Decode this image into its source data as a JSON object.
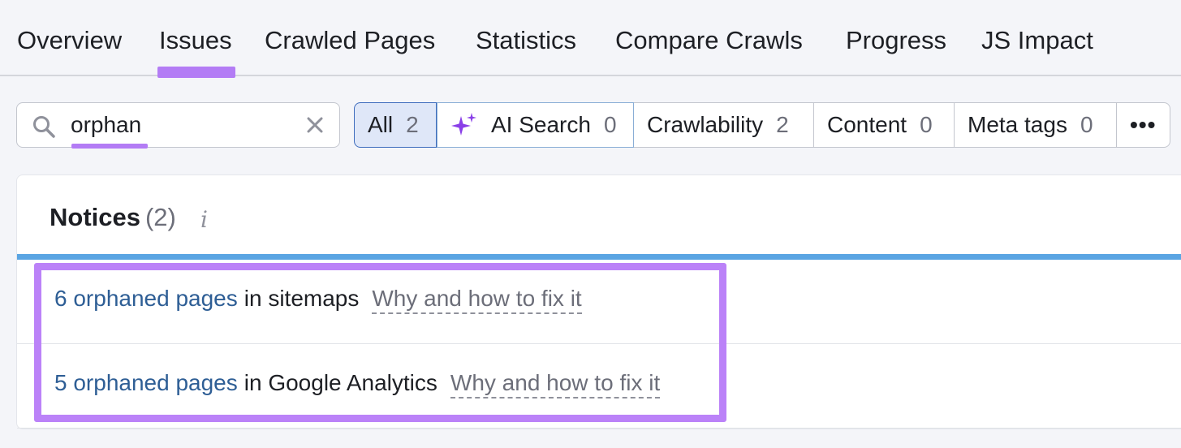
{
  "tabs": [
    {
      "label": "Overview"
    },
    {
      "label": "Issues",
      "active": true
    },
    {
      "label": "Crawled Pages"
    },
    {
      "label": "Statistics"
    },
    {
      "label": "Compare Crawls"
    },
    {
      "label": "Progress"
    },
    {
      "label": "JS Impact"
    }
  ],
  "search": {
    "value": "orphan",
    "search_icon": "search-icon",
    "clear_icon": "close-icon"
  },
  "filters": [
    {
      "label": "All",
      "count": "2",
      "selected": true
    },
    {
      "label": "AI Search",
      "count": "0",
      "icon": "sparkle-icon"
    },
    {
      "label": "Crawlability",
      "count": "2"
    },
    {
      "label": "Content",
      "count": "0"
    },
    {
      "label": "Meta tags",
      "count": "0"
    },
    {
      "label": "•••",
      "icon": "more-icon"
    }
  ],
  "notices": {
    "title": "Notices",
    "count": "(2)",
    "info_icon": "info-icon",
    "items": [
      {
        "link": "6 orphaned pages",
        "text": "in sitemaps",
        "fix": "Why and how to fix it"
      },
      {
        "link": "5 orphaned pages",
        "text": "in Google Analytics",
        "fix": "Why and how to fix it"
      }
    ]
  },
  "colors": {
    "accent_purple": "#b37cf5",
    "highlight_purple": "#bb82f8",
    "link_blue": "#2e5e95",
    "bar_blue": "#5aa5e3",
    "background": "#f4f5f9"
  }
}
